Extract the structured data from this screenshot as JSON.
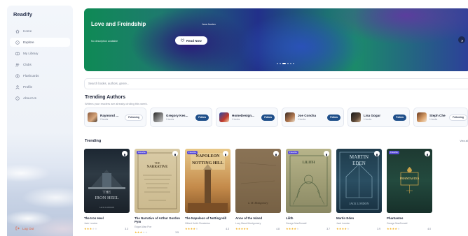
{
  "sidebar": {
    "brand": "Readify",
    "items": [
      {
        "label": "Home",
        "icon": "home-icon",
        "active": false
      },
      {
        "label": "Explore",
        "icon": "compass-icon",
        "active": true
      },
      {
        "label": "My Library",
        "icon": "library-icon",
        "active": false
      },
      {
        "label": "Clubs",
        "icon": "users-icon",
        "active": false
      },
      {
        "label": "Flashcards",
        "icon": "cards-icon",
        "active": false
      },
      {
        "label": "Profile",
        "icon": "user-icon",
        "active": false
      },
      {
        "label": "About Us",
        "icon": "info-icon",
        "active": false
      }
    ],
    "logout": "Log Out"
  },
  "hero": {
    "title": "Love and Freindship",
    "author": "Jane Austen",
    "description": "No description available",
    "button": "Read Now",
    "slides": 6,
    "active_slide": 2
  },
  "search": {
    "placeholder": "Search books, authors, genre..."
  },
  "trending_authors": {
    "title": "Trending Authors",
    "subtitle": "Writers your readers are already circling this week.",
    "authors": [
      {
        "name": "Raymond ...",
        "books": "2 books",
        "button": "Following",
        "following": true
      },
      {
        "name": "Gregory Kes...",
        "books": "1 books",
        "button": "Follow",
        "following": false
      },
      {
        "name": "HomeDesign...",
        "books": "1 books",
        "button": "Follow",
        "following": false
      },
      {
        "name": "Joe Concha",
        "books": "1 books",
        "button": "Follow",
        "following": false
      },
      {
        "name": "Lisa Gogar",
        "books": "1 books",
        "button": "Follow",
        "following": false
      },
      {
        "name": "Steph Che",
        "books": "1 books",
        "button": "Following",
        "following": true
      }
    ]
  },
  "trending": {
    "title": "Trending",
    "view_all": "View all",
    "books": [
      {
        "title": "The Iron Heel",
        "author": "Jack London",
        "rating": "3.3",
        "stars": 3,
        "badge": "",
        "cover_text": [
          "THE",
          "IRON HEEL",
          "JACK LONDON"
        ]
      },
      {
        "title": "The Narrative of Arthur Gordon Pym",
        "author": "Edgar Allan Poe",
        "rating": "3.5",
        "stars": 3,
        "badge": "Favorite",
        "cover_text": [
          "THE",
          "NARRATIVE"
        ]
      },
      {
        "title": "The Napoleon of Notting Hill",
        "author": "Gilbert Keith Chesterton",
        "rating": "4.3",
        "stars": 4,
        "badge": "Favorite",
        "cover_text": [
          "NAPOLEON",
          "NOTTING HILL"
        ]
      },
      {
        "title": "Anne of the Island",
        "author": "Lucy Maud Montgomery",
        "rating": "4.8",
        "stars": 5,
        "badge": "",
        "cover_text": [
          "L. M. Montgomery"
        ]
      },
      {
        "title": "Lilith",
        "author": "George MacDonald",
        "rating": "3.7",
        "stars": 4,
        "badge": "Favorite",
        "cover_text": [
          "LILITH"
        ]
      },
      {
        "title": "Martin Eden",
        "author": "Jack London",
        "rating": "3.9",
        "stars": 4,
        "badge": "",
        "cover_text": [
          "MARTIN",
          "EDEN",
          "JACK LONDON"
        ]
      },
      {
        "title": "Phantastes",
        "author": "George MacDonald",
        "rating": "4.0",
        "stars": 4,
        "badge": "Favorite",
        "cover_text": [
          "PHANTASTES"
        ]
      }
    ]
  },
  "colors": {
    "accent": "#1f4f8a",
    "badge": "#5b4fd8",
    "star": "#f2b01e",
    "logout": "#e0603f"
  }
}
